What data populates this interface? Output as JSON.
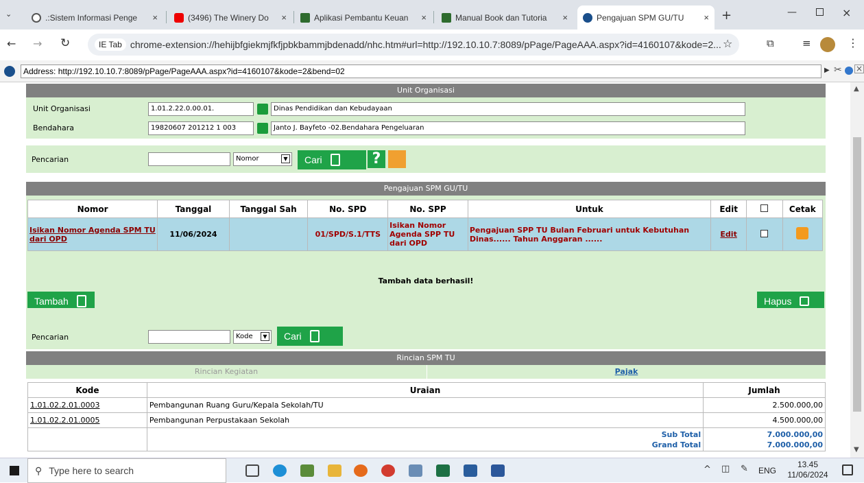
{
  "browser": {
    "tabs": [
      {
        "title": ".:Sistem Informasi Penge",
        "icon": "globe-icon"
      },
      {
        "title": "(3496) The Winery Do",
        "icon": "youtube-icon"
      },
      {
        "title": "Aplikasi Pembantu Keuan",
        "icon": "app-logo-icon"
      },
      {
        "title": "Manual Book dan Tutoria",
        "icon": "app-logo-icon"
      },
      {
        "title": "Pengajuan SPM GU/TU",
        "icon": "ie-icon"
      }
    ],
    "ietab_label": "IE Tab",
    "url": "chrome-extension://hehijbfgiekmjfkfjpbkbammjbdenadd/nhc.htm#url=http://192.10.10.7:8089/pPage/PageAAA.aspx?id=4160107&kode=2...",
    "ie_address_label": "Address:",
    "ie_address": "http://192.10.10.7:8089/pPage/PageAAA.aspx?id=4160107&kode=2&bend=02"
  },
  "unit": {
    "header": "Unit Organisasi",
    "unit_label": "Unit Organisasi",
    "unit_code": "1.01.2.22.0.00.01.",
    "unit_name": "Dinas Pendidikan dan Kebudayaan",
    "bendahara_label": "Bendahara",
    "bendahara_code": "19820607 201212 1 003",
    "bendahara_name": "Janto J. Bayfeto -02.Bendahara Pengeluaran"
  },
  "search1": {
    "label": "Pencarian",
    "select": "Nomor",
    "button": "Cari"
  },
  "spm": {
    "header": "Pengajuan SPM GU/TU",
    "columns": [
      "Nomor",
      "Tanggal",
      "Tanggal Sah",
      "No. SPD",
      "No. SPP",
      "Untuk",
      "Edit",
      "Cetak"
    ],
    "row": {
      "nomor": "Isikan Nomor Agenda SPM TU dari OPD",
      "tanggal": "11/06/2024",
      "tanggal_sah": "",
      "no_spd": "01/SPD/S.1/TTS",
      "no_spp": "Isikan Nomor Agenda SPP TU dari OPD",
      "untuk": "Pengajuan SPP TU Bulan Februari untuk Kebutuhan Dinas...... Tahun Anggaran ......",
      "edit": "Edit"
    },
    "message": "Tambah data berhasil!"
  },
  "buttons": {
    "tambah": "Tambah",
    "hapus": "Hapus"
  },
  "search2": {
    "label": "Pencarian",
    "select": "Kode",
    "button": "Cari"
  },
  "rincian": {
    "header": "Rincian SPM TU",
    "tab_kegiatan": "Rincian Kegiatan",
    "tab_pajak": "Pajak",
    "columns": [
      "Kode",
      "Uraian",
      "Jumlah"
    ],
    "rows": [
      {
        "kode": "1.01.02.2.01.0003",
        "uraian": "Pembangunan Ruang Guru/Kepala Sekolah/TU",
        "jumlah": "2.500.000,00"
      },
      {
        "kode": "1.01.02.2.01.0005",
        "uraian": "Pembangunan Perpustakaan Sekolah",
        "jumlah": "4.500.000,00"
      }
    ],
    "subtotal_label": "Sub Total",
    "subtotal": "7.000.000,00",
    "grandtotal_label": "Grand Total",
    "grandtotal": "7.000.000,00"
  },
  "taskbar": {
    "search_placeholder": "Type here to search",
    "lang": "ENG",
    "time": "13.45",
    "date": "11/06/2024"
  }
}
